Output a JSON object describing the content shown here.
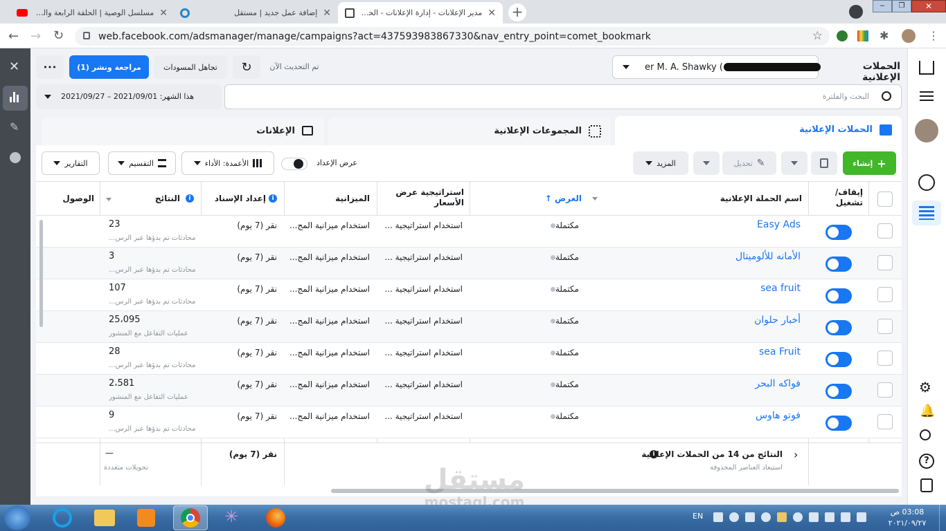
{
  "browser": {
    "tabs": [
      {
        "title": "مسلسل الوصية | الحلقة الرابعة والعشرون",
        "active": false
      },
      {
        "title": "إضافة عمل جديد | مستقل",
        "active": false
      },
      {
        "title": "مدير الإعلانات - إدارة الإعلانات - الحملات",
        "active": true
      }
    ],
    "url": "web.facebook.com/adsmanager/manage/campaigns?act=437593983867330&nav_entry_point=comet_bookmark"
  },
  "header": {
    "page_title": "الحملات الإعلانية",
    "account_name": "er M. A. Shawky (",
    "updated_text": "تم التحديث الآن",
    "discard_label": "تجاهل المسودات",
    "review_label": "مراجعة ونشر (1)",
    "more_label": "•••"
  },
  "filters": {
    "search_placeholder": "البحث والفلترة",
    "date_range": "هذا الشهر: 2021/09/01 – 2021/09/27"
  },
  "level_tabs": [
    {
      "label": "الحملات الإعلانية",
      "active": true
    },
    {
      "label": "المجموعات الإعلانية",
      "active": false
    },
    {
      "label": "الإعلانات",
      "active": false
    }
  ],
  "actions": {
    "create": "إنشاء",
    "edit": "تحديل",
    "more": "المزيد",
    "view_setup": "عرض الإعداد",
    "columns": "الأعمدة: الأداء",
    "breakdown": "التقسيم",
    "reports": "التقارير"
  },
  "table": {
    "headers": {
      "toggle": "إيقاف/ تشغيل",
      "name": "اسم الحملة الإعلانية",
      "delivery": "العرض ↑",
      "bid": "استراتيجية عرض الأسعار",
      "budget": "الميزانية",
      "attribution": "إعداد الإسناد",
      "results": "النتائج",
      "reach": "الوصول"
    },
    "rows": [
      {
        "name": "Easy Ads",
        "delivery": "مكتملة",
        "bid": "استخدام استراتيجية ...",
        "budget": "استخدام ميزانية المج...",
        "attribution": "نقر (7 يوم)",
        "result": "23",
        "result_type": "محادثات تم بدؤها عبر الرس..."
      },
      {
        "name": "الأمانه للألوميتال",
        "delivery": "مكتملة",
        "bid": "استخدام استراتيجية ...",
        "budget": "استخدام ميزانية المج...",
        "attribution": "نقر (7 يوم)",
        "result": "3",
        "result_type": "محادثات تم بدؤها عبر الرس..."
      },
      {
        "name": "sea fruit",
        "delivery": "مكتملة",
        "bid": "استخدام استراتيجية ...",
        "budget": "استخدام ميزانية المج...",
        "attribution": "نقر (7 يوم)",
        "result": "107",
        "result_type": "محادثات تم بدؤها عبر الرس..."
      },
      {
        "name": "أخبار حلوان",
        "delivery": "مكتملة",
        "bid": "استخدام استراتيجية ...",
        "budget": "استخدام ميزانية المج...",
        "attribution": "نقر (7 يوم)",
        "result": "25،095",
        "result_type": "عمليات التفاعل مع المنشور"
      },
      {
        "name": "sea Fruit",
        "delivery": "مكتملة",
        "bid": "استخدام استراتيجية ...",
        "budget": "استخدام ميزانية المج...",
        "attribution": "نقر (7 يوم)",
        "result": "28",
        "result_type": "محادثات تم بدؤها عبر الرس..."
      },
      {
        "name": "فواكه البحر",
        "delivery": "مكتملة",
        "bid": "استخدام استراتيجية ...",
        "budget": "استخدام ميزانية المج...",
        "attribution": "نقر (7 يوم)",
        "result": "2،581",
        "result_type": "عمليات التفاعل مع المنشور"
      },
      {
        "name": "فوتو هاوس",
        "delivery": "مكتملة",
        "bid": "استخدام استراتيجية ...",
        "budget": "استخدام ميزانية المج...",
        "attribution": "نقر (7 يوم)",
        "result": "9",
        "result_type": "محادثات تم بدؤها عبر الرس..."
      }
    ],
    "footer": {
      "summary": "النتائج من 14 من الحملات الإعلانية",
      "excluded": "استبعاد العناصر المحذوفة",
      "attribution": "نقر (7 يوم)",
      "result": "—",
      "result_type": "تحويلات متعددة"
    }
  },
  "watermark": {
    "ar": "مستقل",
    "en": "mostaql.com"
  },
  "taskbar": {
    "lang": "EN",
    "time": "03:08 ص",
    "date": "٢٠٢١/٠٩/٢٧"
  }
}
